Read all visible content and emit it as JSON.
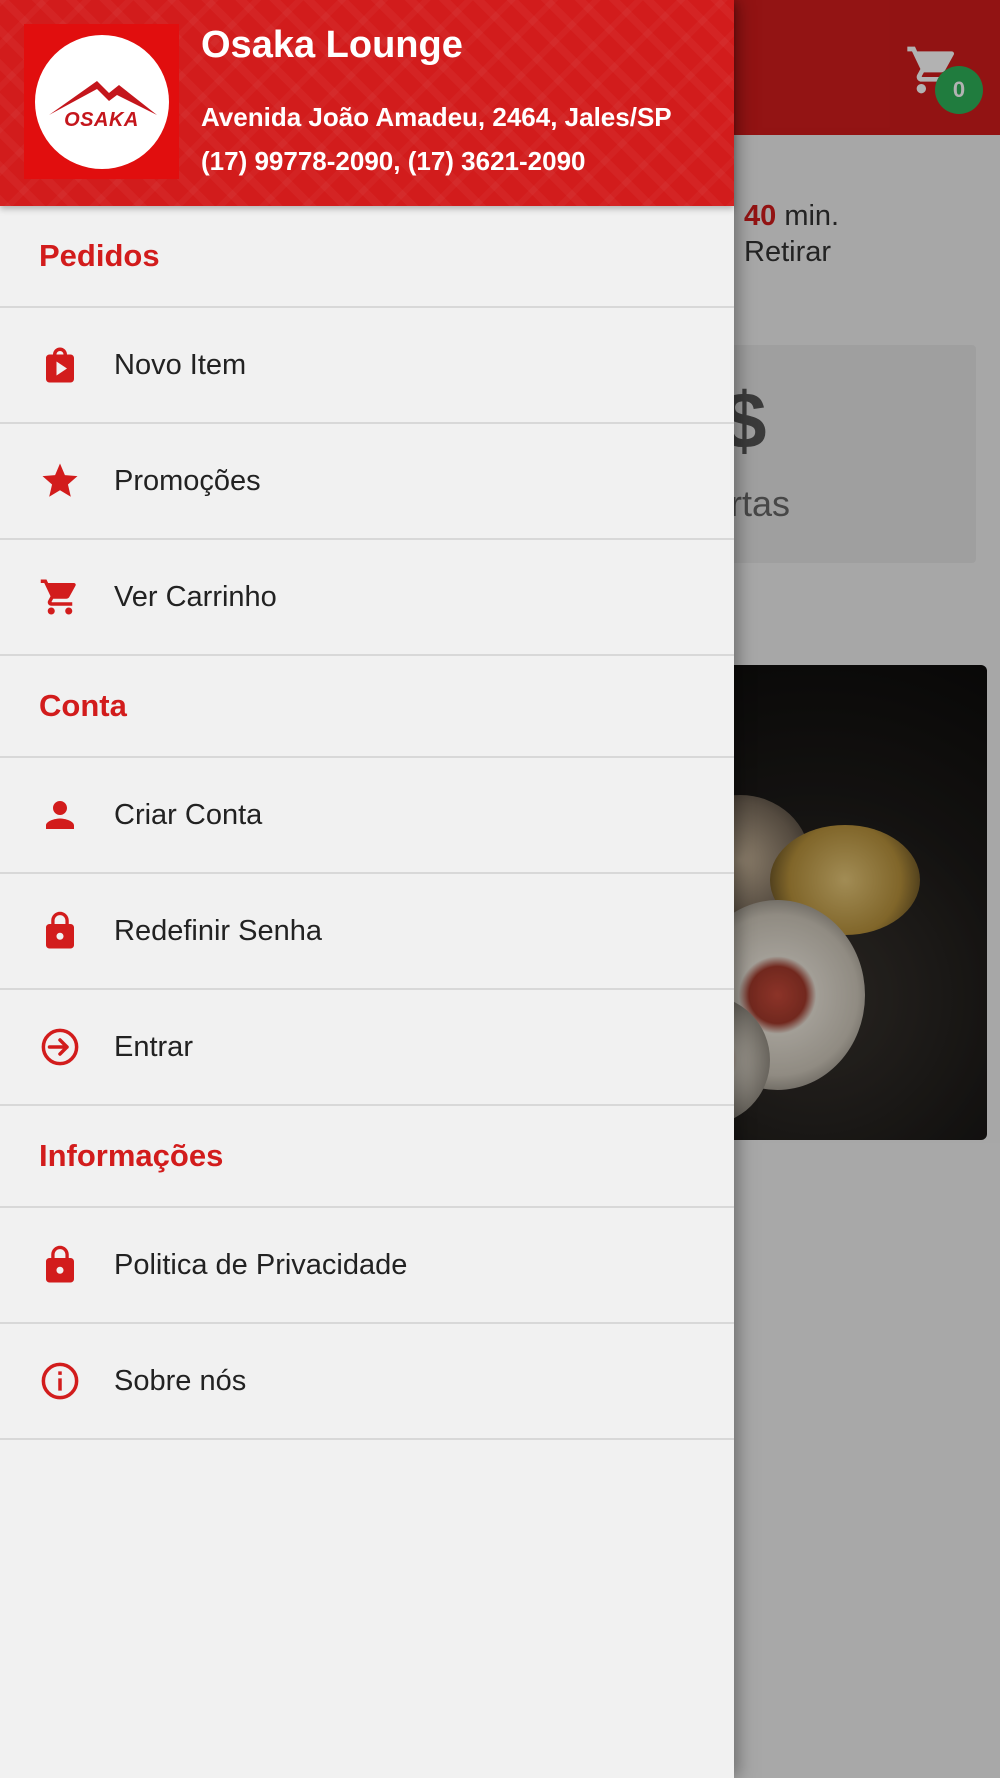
{
  "header": {
    "store_name": "Osaka Lounge",
    "address": "Avenida João Amadeu, 2464, Jales/SP",
    "phones": "(17) 99778-2090, (17) 3621-2090",
    "logo_text": "OSAKA"
  },
  "background": {
    "cart_count": "0",
    "time_value": "40",
    "time_unit": "min.",
    "pickup_label": "Retirar",
    "offer_symbol": "$",
    "offer_label": "ertas"
  },
  "sections": [
    {
      "title": "Pedidos",
      "items": [
        {
          "label": "Novo Item",
          "icon": "shopping-bag-icon"
        },
        {
          "label": "Promoções",
          "icon": "star-icon"
        },
        {
          "label": "Ver Carrinho",
          "icon": "cart-icon"
        }
      ]
    },
    {
      "title": "Conta",
      "items": [
        {
          "label": "Criar Conta",
          "icon": "person-icon"
        },
        {
          "label": "Redefinir Senha",
          "icon": "lock-icon"
        },
        {
          "label": "Entrar",
          "icon": "login-icon"
        }
      ]
    },
    {
      "title": "Informações",
      "items": [
        {
          "label": "Politica de Privacidade",
          "icon": "lock-icon"
        },
        {
          "label": "Sobre nós",
          "icon": "info-icon"
        }
      ]
    }
  ],
  "colors": {
    "brand_red": "#d21c1c",
    "badge_green": "#2fb25a",
    "drawer_bg": "#f1f1f1"
  }
}
